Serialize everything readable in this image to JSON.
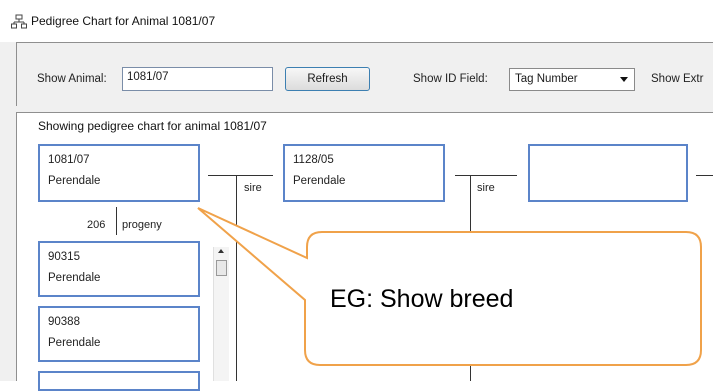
{
  "window": {
    "title": "Pedigree Chart for Animal 1081/07",
    "icon": "pedigree-tree-icon"
  },
  "toolbar": {
    "show_animal_label": "Show Animal:",
    "show_animal_value": "1081/07",
    "refresh_label": "Refresh",
    "show_id_field_label": "Show ID Field:",
    "show_id_field_value": "Tag Number",
    "show_extra_label": "Show Extr"
  },
  "chart": {
    "heading": "Showing pedigree chart for animal 1081/07",
    "subject": {
      "id": "1081/07",
      "breed": "Perendale"
    },
    "sire": {
      "id": "1128/05",
      "breed": "Perendale"
    },
    "sire_label_1": "sire",
    "sire_label_2": "sire",
    "progeny_count": "206",
    "progeny_label": "progeny",
    "progeny": [
      {
        "id": "90315",
        "breed": "Perendale"
      },
      {
        "id": "90388",
        "breed": "Perendale"
      }
    ]
  },
  "callout": {
    "text": "EG: Show breed",
    "border_color": "#f0a24a"
  },
  "colors": {
    "box_border": "#5b84c9",
    "button_border": "#3c7fb1"
  }
}
